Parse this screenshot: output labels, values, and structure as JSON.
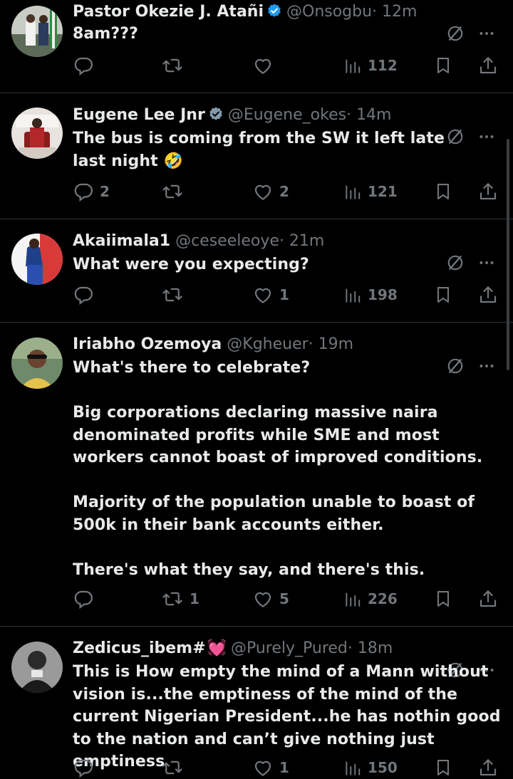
{
  "tweets": [
    {
      "name": "Pastor Okezie J. Atañi",
      "handle": "@Onsogbu",
      "time": "· 12m",
      "text": "8am???",
      "replies": "",
      "retweets": "",
      "likes": "",
      "views": "112",
      "verified": "blue"
    },
    {
      "name": "Eugene Lee Jnr",
      "handle": "@Eugene_okes",
      "time": "· 14m",
      "text": "The bus is coming from the SW it left late last night 🤣",
      "replies": "2",
      "retweets": "",
      "likes": "2",
      "views": "121",
      "verified": "gray"
    },
    {
      "name": "Akaiimala1",
      "handle": "@ceseeleoye",
      "time": "· 21m",
      "text": "What were you expecting?",
      "replies": "",
      "retweets": "",
      "likes": "1",
      "views": "198"
    },
    {
      "name": "Iriabho Ozemoya",
      "handle": "@Kgheuer",
      "time": "· 19m",
      "text": "What's there to celebrate?\n\nBig corporations declaring massive naira denominated profits while SME and most workers cannot boast of improved conditions.\n\nMajority of the population unable to boast of 500k in their bank accounts either.\n\nThere's what they say, and there's this.",
      "replies": "",
      "retweets": "1",
      "likes": "5",
      "views": "226"
    },
    {
      "name": "Zedicus_ibem#",
      "name_emoji": "💓",
      "handle": "@Purely_Pured",
      "time": "· 18m",
      "text": "This is How empty the mind of a Mann without vision is...the emptiness of the mind of the current Nigerian President...he has nothin good to the nation and can’t give nothing just emptiness",
      "replies": "",
      "retweets": "",
      "likes": "1",
      "views": "150"
    }
  ],
  "icons": {
    "verified": "verified-badge-icon",
    "grok": "grok-icon",
    "more": "more-icon",
    "reply": "reply-icon",
    "retweet": "retweet-icon",
    "like": "like-icon",
    "views": "views-icon",
    "bookmark": "bookmark-icon",
    "share": "share-icon"
  },
  "colors": {
    "background": "#000000",
    "text": "#e7e9ea",
    "secondary": "#71767b",
    "divider": "#2f3336",
    "verified_blue": "#1d9bf0"
  }
}
